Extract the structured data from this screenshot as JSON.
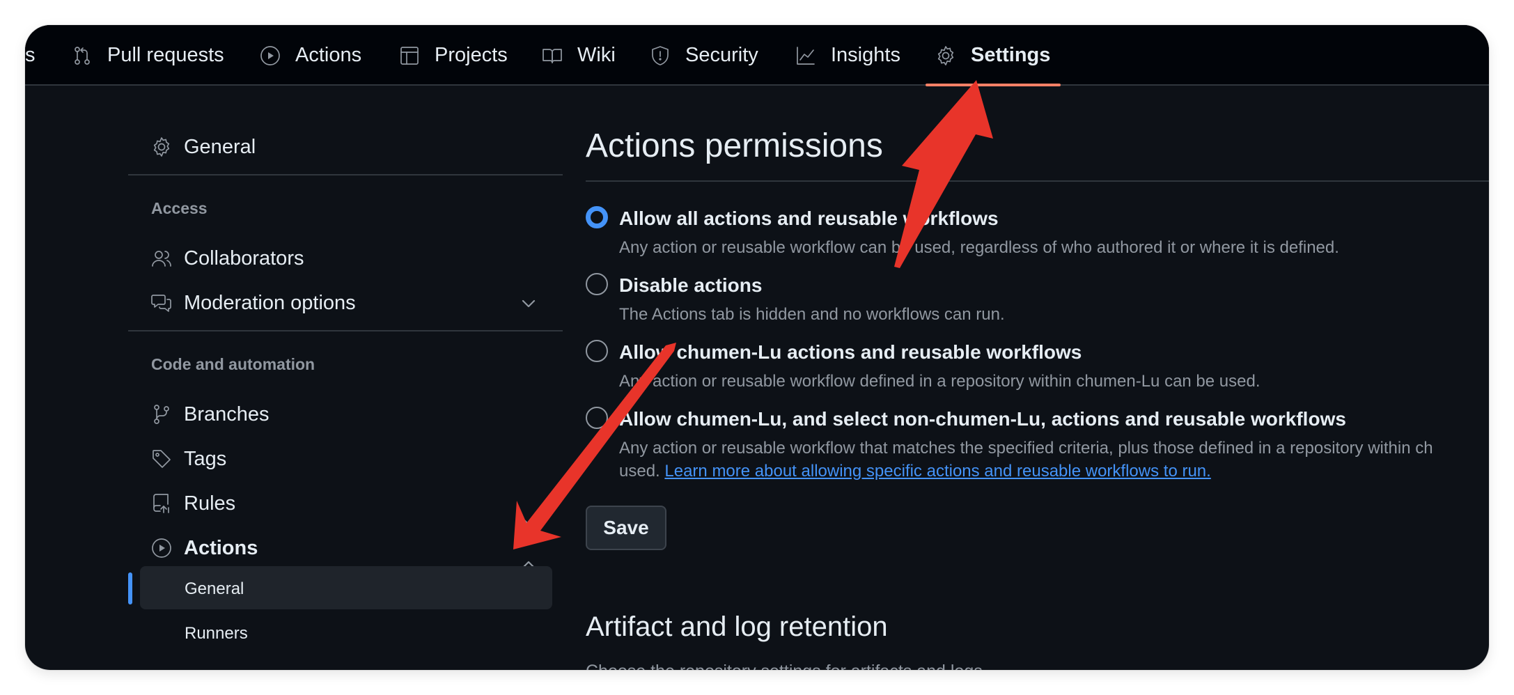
{
  "topnav": {
    "tabs": [
      {
        "label": "s",
        "icon": "partial-tab"
      },
      {
        "label": "Pull requests",
        "icon": "pull-request-icon"
      },
      {
        "label": "Actions",
        "icon": "play-icon"
      },
      {
        "label": "Projects",
        "icon": "table-icon"
      },
      {
        "label": "Wiki",
        "icon": "book-icon"
      },
      {
        "label": "Security",
        "icon": "shield-icon"
      },
      {
        "label": "Insights",
        "icon": "graph-icon"
      },
      {
        "label": "Settings",
        "icon": "gear-icon",
        "active": true
      }
    ]
  },
  "sidebar": {
    "general": "General",
    "access_heading": "Access",
    "collaborators": "Collaborators",
    "moderation": "Moderation options",
    "code_heading": "Code and automation",
    "branches": "Branches",
    "tags": "Tags",
    "rules": "Rules",
    "actions": "Actions",
    "actions_general": "General",
    "actions_runners": "Runners"
  },
  "main": {
    "title": "Actions permissions",
    "options": [
      {
        "label": "Allow all actions and reusable workflows",
        "desc": "Any action or reusable workflow can be used, regardless of who authored it or where it is defined.",
        "checked": true
      },
      {
        "label": "Disable actions",
        "desc": "The Actions tab is hidden and no workflows can run.",
        "checked": false
      },
      {
        "label": "Allow chumen-Lu actions and reusable workflows",
        "desc": "Any action or reusable workflow defined in a repository within chumen-Lu can be used.",
        "checked": false
      },
      {
        "label": "Allow chumen-Lu, and select non-chumen-Lu, actions and reusable workflows",
        "desc": "Any action or reusable workflow that matches the specified criteria, plus those defined in a repository within ch",
        "desc2": "used.",
        "link": "Learn more about allowing specific actions and reusable workflows to run.",
        "checked": false
      }
    ],
    "save_label": "Save",
    "section2_title": "Artifact and log retention",
    "section2_partial": "Choose the repository settings for artifacts and logs"
  },
  "colors": {
    "background": "#0d1117",
    "nav_background": "#010409",
    "accent": "#4493f8",
    "tab_underline": "#f78166",
    "annotation_arrow": "#e8342a"
  }
}
